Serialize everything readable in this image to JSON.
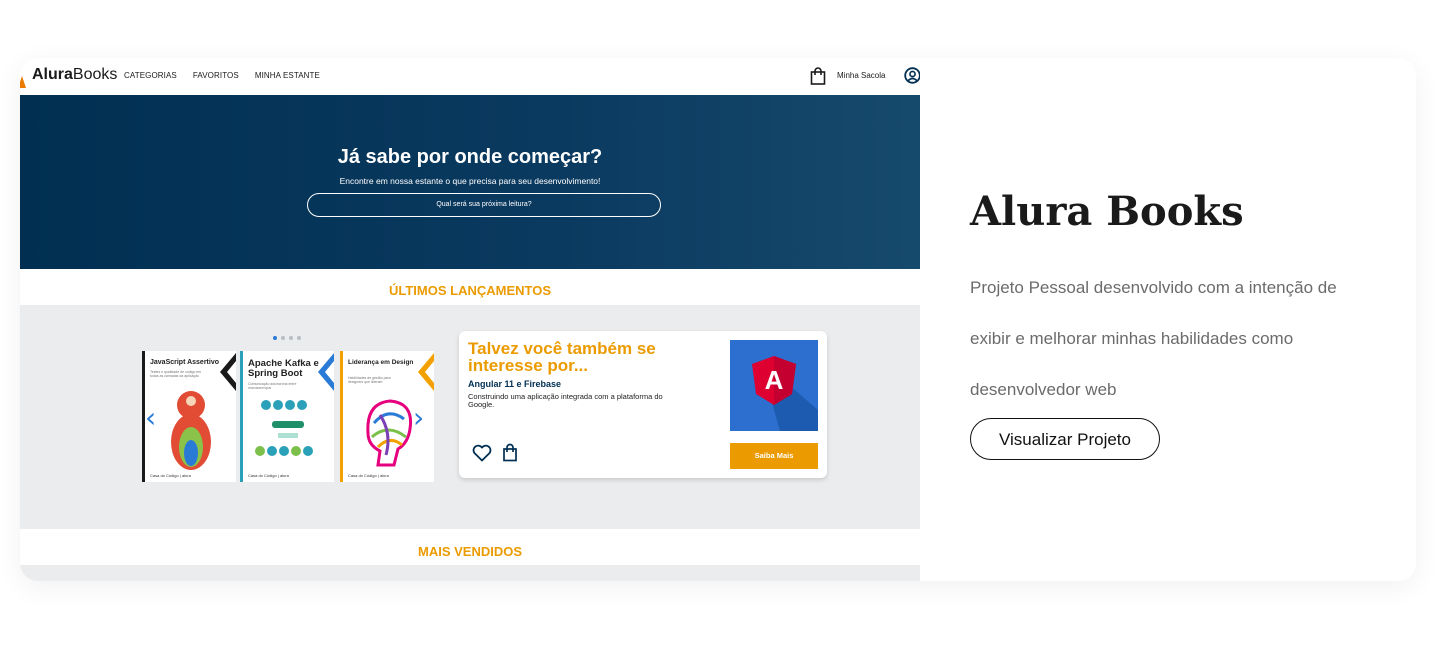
{
  "screenshot": {
    "logo": {
      "brand_bold": "Alura",
      "brand_rest": "Books"
    },
    "nav": {
      "items": [
        "CATEGORIAS",
        "FAVORITOS",
        "MINHA ESTANTE"
      ],
      "bag_label": "Minha Sacola"
    },
    "hero": {
      "title": "Já sabe por onde começar?",
      "subtitle": "Encontre em nossa estante o que precisa para seu desenvolvimento!",
      "search_placeholder": "Qual será sua próxima leitura?"
    },
    "section_latest": "ÚLTIMOS LANÇAMENTOS",
    "books": [
      {
        "title": "JavaScript Assertivo",
        "subtitle": "Testes e qualidade de código em todas as camadas da aplicação",
        "accent": "#1a1a1a",
        "footer": "Casa do Código | alura"
      },
      {
        "title": "Apache Kafka e Spring Boot",
        "subtitle": "Comunicação assíncrona entre microsserviços",
        "accent": "#2aa1b8",
        "footer": "Casa do Código | alura"
      },
      {
        "title": "Liderança em Design",
        "subtitle": "Habilidades de gestão para designers que lideram",
        "accent": "#f2a100",
        "footer": "Casa do Código | alura"
      }
    ],
    "promo": {
      "title": "Talvez você também se interesse por...",
      "book_title": "Angular 11 e Firebase",
      "description": "Construindo uma aplicação integrada com a plataforma do Google.",
      "button": "Saiba Mais",
      "image_letter": "A"
    },
    "section_best": "MAIS VENDIDOS"
  },
  "panel": {
    "title": "Alura Books",
    "description": "Projeto Pessoal desenvolvido com a intenção de exibir e melhorar minhas habilidades como desenvolvedor web",
    "button": "Visualizar Projeto"
  },
  "colors": {
    "accent": "#eb9b00",
    "navy": "#002f52",
    "link_blue": "#2a7bd6"
  }
}
